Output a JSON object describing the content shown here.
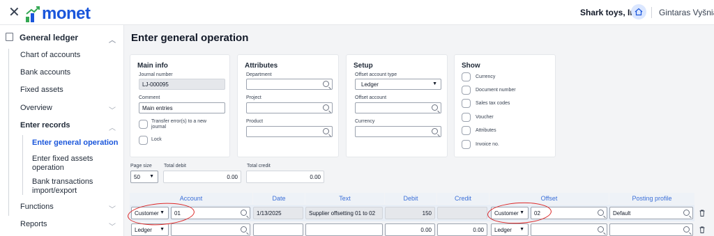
{
  "topbar": {
    "brand": "monet",
    "company": "Shark toys, Inc.",
    "user": "Gintaras Vyšniauskas"
  },
  "sidebar": {
    "section": "General ledger",
    "items": [
      {
        "label": "Chart of accounts"
      },
      {
        "label": "Bank accounts"
      },
      {
        "label": "Fixed assets"
      },
      {
        "label": "Overview"
      },
      {
        "label": "Enter records"
      },
      {
        "label": "Enter general operation"
      },
      {
        "label": "Enter fixed assets operation"
      },
      {
        "label": "Bank transactions import/export"
      },
      {
        "label": "Functions"
      },
      {
        "label": "Reports"
      }
    ]
  },
  "page": {
    "title": "Enter general operation"
  },
  "main_info": {
    "heading": "Main info",
    "journal_label": "Journal number",
    "journal_value": "LJ-000095",
    "comment_label": "Comment",
    "comment_value": "Main entries",
    "transfer_label": "Transfer error(s) to a new journal",
    "lock_label": "Lock"
  },
  "attributes": {
    "heading": "Attributes",
    "department_label": "Department",
    "project_label": "Project",
    "product_label": "Product"
  },
  "setup": {
    "heading": "Setup",
    "offset_type_label": "Offset account type",
    "offset_type_value": "Ledger",
    "offset_account_label": "Offset account",
    "currency_label": "Currency"
  },
  "show": {
    "heading": "Show",
    "options": [
      "Currency",
      "Document number",
      "Sales tax codes",
      "Voucher",
      "Attributes",
      "Invoice no."
    ]
  },
  "totals": {
    "page_size_label": "Page size",
    "page_size_value": "50",
    "total_debit_label": "Total debit",
    "total_debit_value": "0.00",
    "total_credit_label": "Total credit",
    "total_credit_value": "0.00"
  },
  "table": {
    "headers": [
      "Account",
      "Date",
      "Text",
      "Debit",
      "Credit",
      "Offset",
      "Posting profile"
    ],
    "rows": [
      {
        "account_type": "Customer",
        "account": "01",
        "date": "1/13/2025",
        "text": "Supplier offsetting 01 to 02",
        "debit": "150",
        "credit": "",
        "offset_type": "Customer",
        "offset": "02",
        "posting_profile": "Default"
      },
      {
        "account_type": "Ledger",
        "account": "",
        "date": "",
        "text": "",
        "debit": "0.00",
        "credit": "0.00",
        "offset_type": "Ledger",
        "offset": "",
        "posting_profile": ""
      }
    ]
  },
  "colors": {
    "accent": "#1a56db",
    "annotation": "#dc2626"
  }
}
